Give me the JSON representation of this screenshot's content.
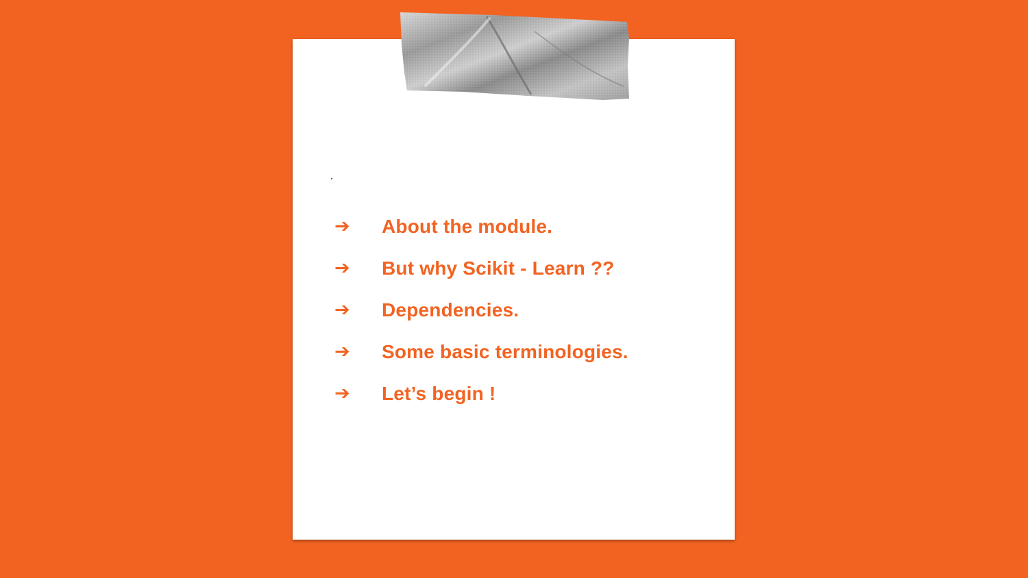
{
  "slide": {
    "background_color": "#f26322",
    "paper_color": "#ffffff",
    "accent_color": "#f26322",
    "bullet_icon": "right-arrow-icon",
    "items": [
      {
        "arrow": "➔",
        "text": "About the module."
      },
      {
        "arrow": "➔",
        "text": "But why Scikit - Learn ??"
      },
      {
        "arrow": "➔",
        "text": "Dependencies."
      },
      {
        "arrow": "➔",
        "text": "Some basic terminologies."
      },
      {
        "arrow": "➔",
        "text": "Let’s begin !"
      }
    ]
  }
}
